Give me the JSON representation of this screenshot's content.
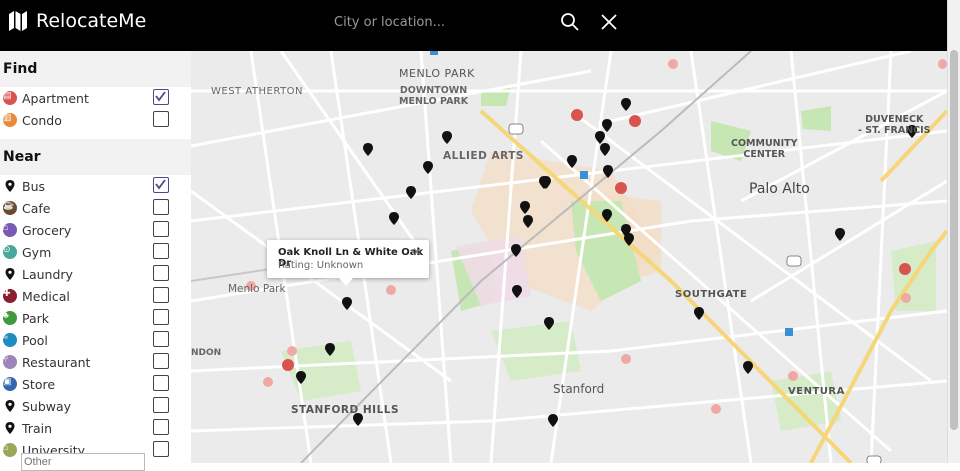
{
  "app": {
    "name": "RelocateMe"
  },
  "search": {
    "placeholder": "City or location..."
  },
  "sidebar": {
    "find_title": "Find",
    "find_items": [
      {
        "label": "Apartment",
        "checked": true,
        "icon": "apartment-icon",
        "color": "#d9534f"
      },
      {
        "label": "Condo",
        "checked": false,
        "icon": "condo-icon",
        "color": "#e8893b"
      }
    ],
    "near_title": "Near",
    "near_items": [
      {
        "label": "Bus",
        "checked": true,
        "icon": "bus-pin-icon"
      },
      {
        "label": "Cafe",
        "checked": false,
        "icon": "cafe-icon"
      },
      {
        "label": "Grocery",
        "checked": false,
        "icon": "grocery-icon"
      },
      {
        "label": "Gym",
        "checked": false,
        "icon": "gym-icon"
      },
      {
        "label": "Laundry",
        "checked": false,
        "icon": "laundry-pin-icon"
      },
      {
        "label": "Medical",
        "checked": false,
        "icon": "medical-icon"
      },
      {
        "label": "Park",
        "checked": false,
        "icon": "park-icon"
      },
      {
        "label": "Pool",
        "checked": false,
        "icon": "pool-icon"
      },
      {
        "label": "Restaurant",
        "checked": false,
        "icon": "restaurant-icon"
      },
      {
        "label": "Store",
        "checked": false,
        "icon": "store-icon"
      },
      {
        "label": "Subway",
        "checked": false,
        "icon": "subway-pin-icon"
      },
      {
        "label": "Train",
        "checked": false,
        "icon": "train-pin-icon"
      },
      {
        "label": "University",
        "checked": false,
        "icon": "university-icon"
      }
    ],
    "other_placeholder": "Other"
  },
  "map": {
    "popup": {
      "title": "Oak Knoll Ln & White Oak Dr",
      "subtitle": "Rating: Unknown",
      "close": "✕"
    },
    "labels": {
      "menlo_park": "MENLO PARK",
      "downtown": "DOWNTOWN\nMENLO PARK",
      "west_atherton": "WEST ATHERTON",
      "allied_arts": "ALLIED ARTS",
      "community_center": "COMMUNITY\nCENTER",
      "duveneck": "DUVENECK\n- ST. FRANCIS",
      "palo_alto": "Palo Alto",
      "southgate": "SOUTHGATE",
      "stanford": "Stanford",
      "stanford_hills": "STANFORD HILLS",
      "ventura": "VENTURA",
      "menlo_park_sm": "Menlo Park",
      "ndon": "NDON"
    }
  }
}
